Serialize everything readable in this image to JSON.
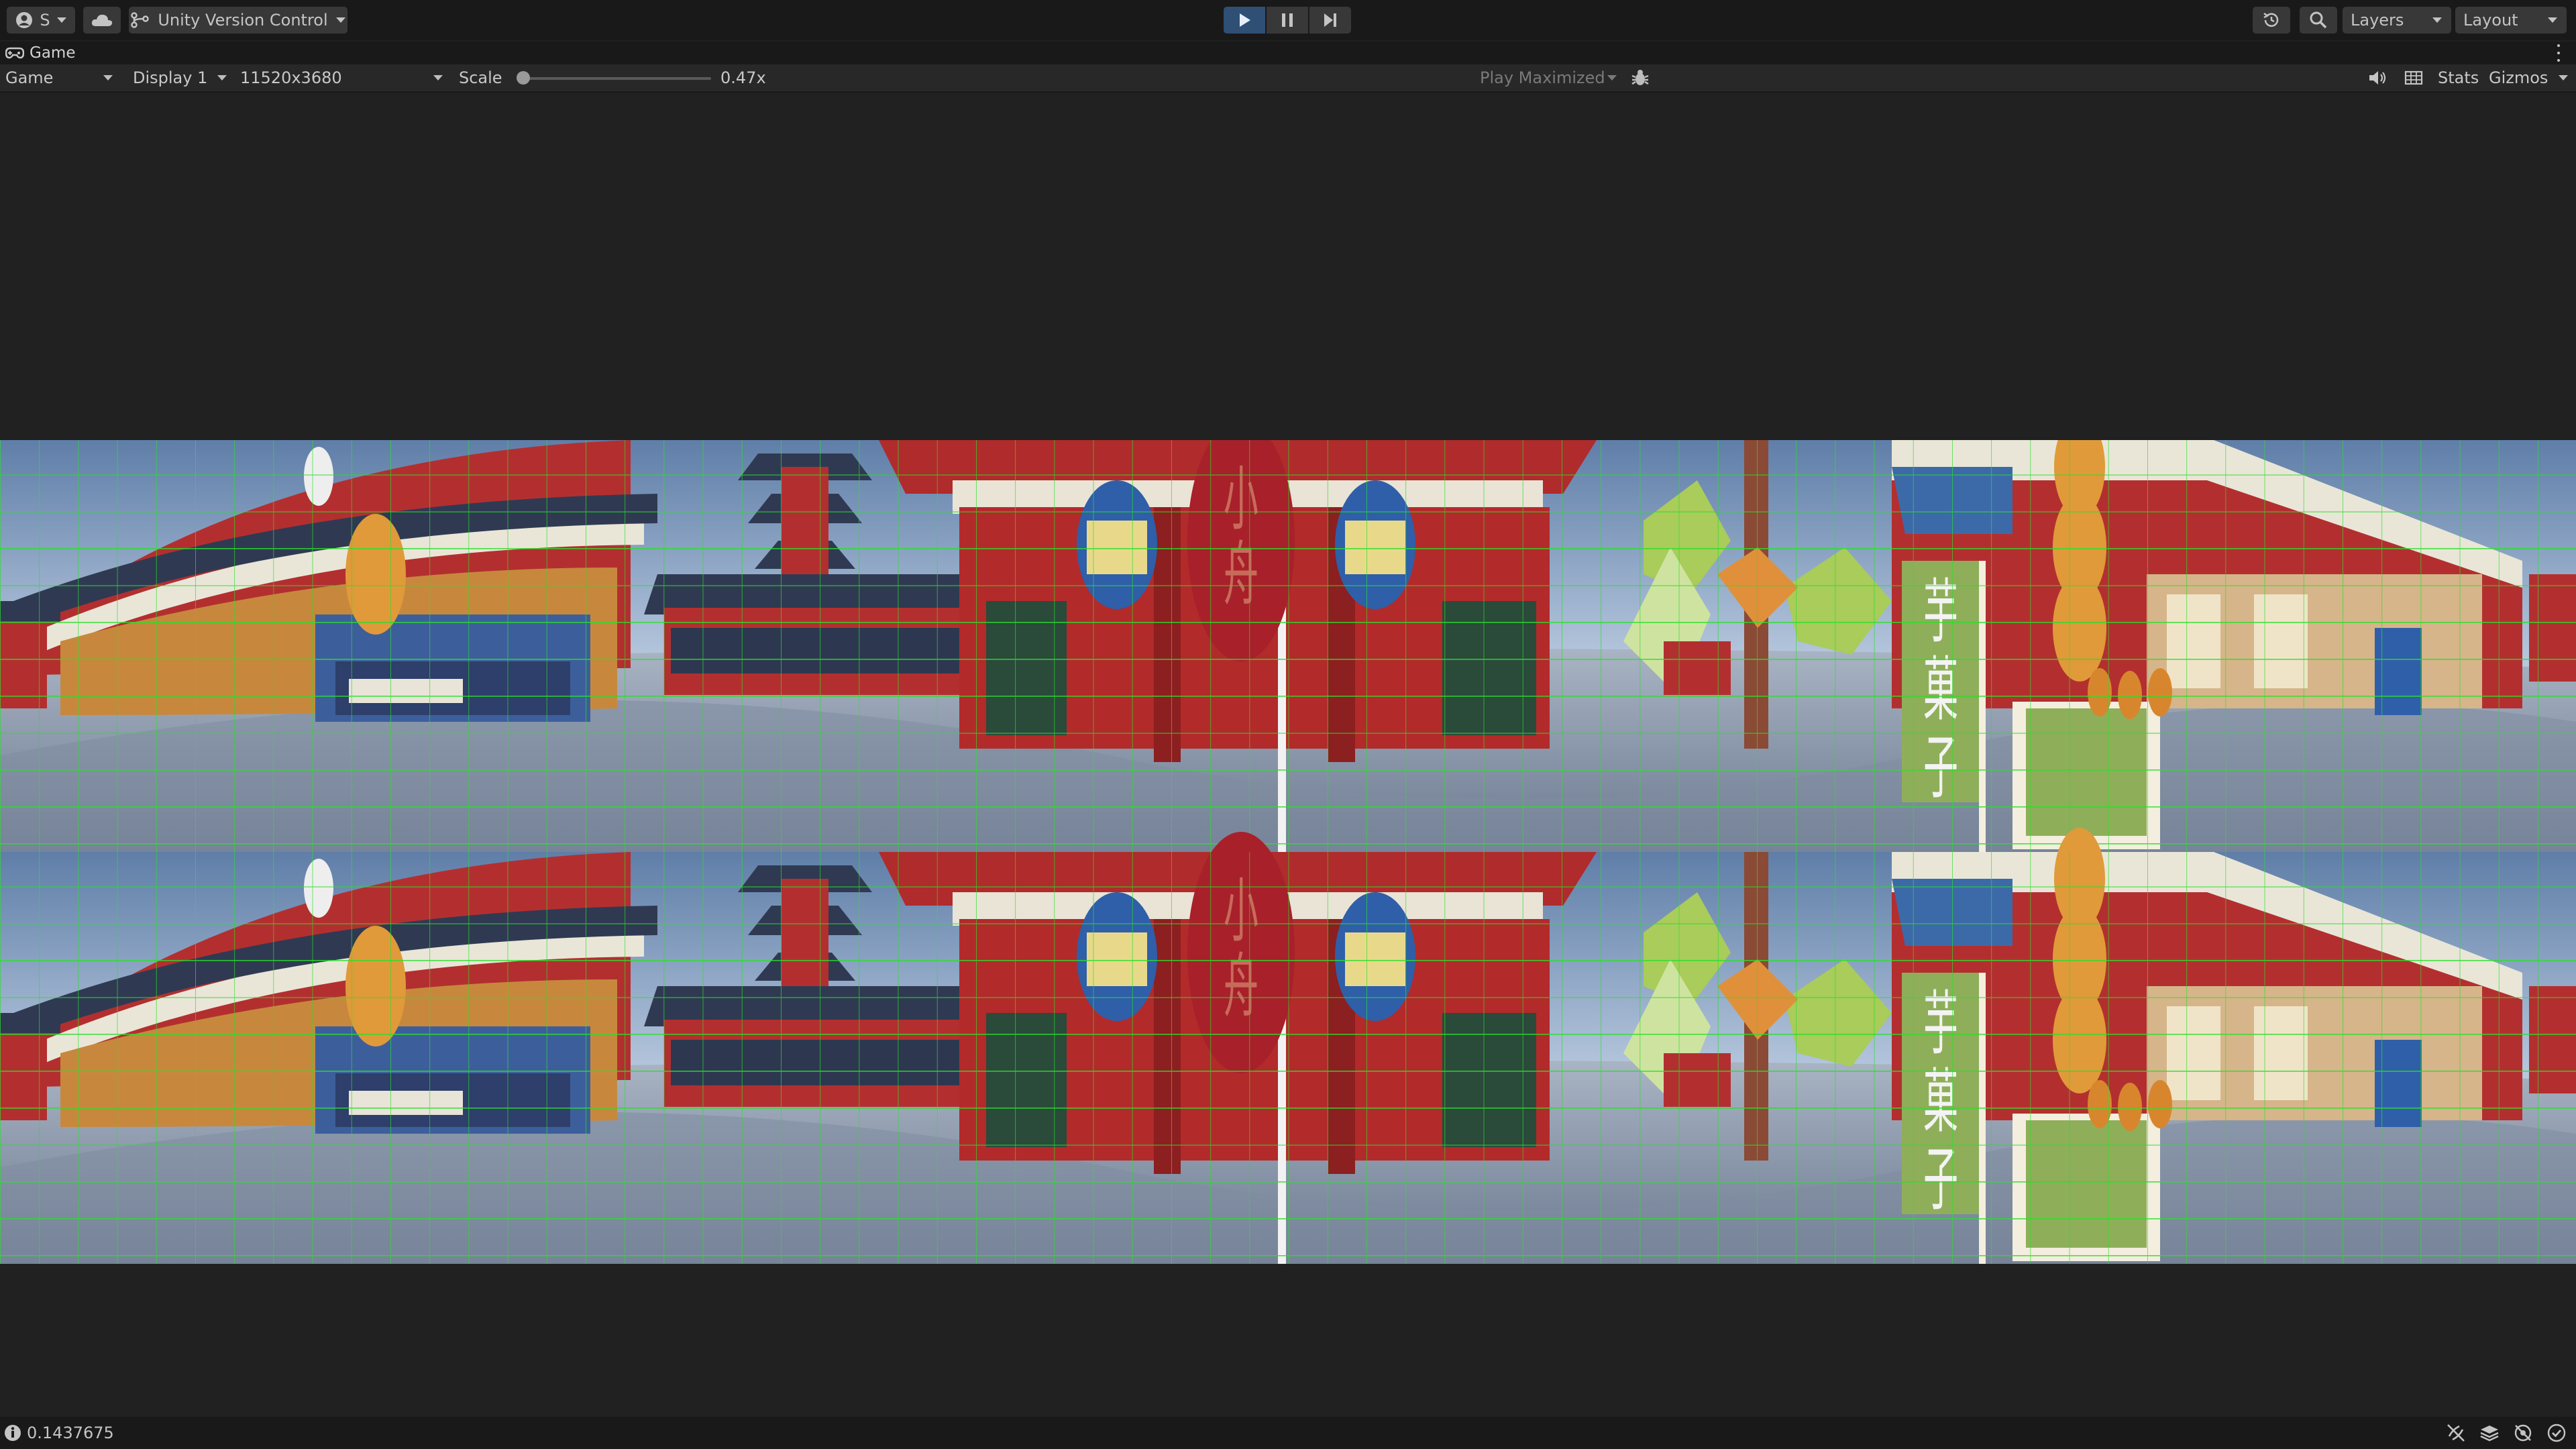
{
  "toolbar": {
    "account_label": "S",
    "version_control_label": "Unity Version Control",
    "layers_label": "Layers",
    "layout_label": "Layout",
    "icons": [
      "account-icon",
      "cloud-icon",
      "version-control-icon",
      "play-icon",
      "pause-icon",
      "step-icon",
      "history-icon",
      "search-icon"
    ]
  },
  "tab": {
    "title": "Game",
    "icon": "gamepad-icon"
  },
  "game_view": {
    "mode": "Game",
    "display": "Display 1",
    "resolution": "11520x3680",
    "scale_label": "Scale",
    "scale_value": "0.47x",
    "scale_fraction": 0.0,
    "play_mode": "Play Maximized",
    "stats_label": "Stats",
    "gizmos_label": "Gizmos",
    "icons": [
      "bug-icon",
      "audio-icon",
      "grid-icon"
    ]
  },
  "scene": {
    "sign_text": [
      "芋",
      "菓",
      "子"
    ],
    "lantern_text": [
      "小",
      "舟"
    ],
    "colors": {
      "sky": "#9fb3cc",
      "ground": "#8793a6",
      "temple_red": "#b32a2a",
      "roof_dark": "#2f3a4f",
      "grid_line": "#2fe02f",
      "sign_green": "#8fae5a",
      "lantern_blue": "#2f5fa8",
      "tree_green": "#a9cc5a"
    }
  },
  "status": {
    "message": "0.1437675",
    "icons": [
      "collab-icon",
      "layers-icon",
      "network-icon",
      "check-icon"
    ]
  }
}
